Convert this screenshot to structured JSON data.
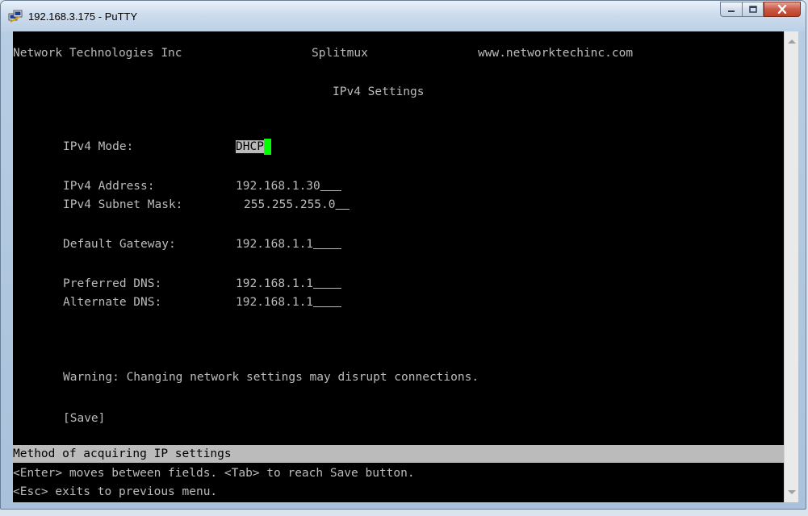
{
  "window": {
    "title": "192.168.3.175 - PuTTY",
    "icon": "putty-icon"
  },
  "controls": {
    "minimize_icon": "minimize-icon",
    "maximize_icon": "maximize-icon",
    "close_icon": "close-icon"
  },
  "terminal": {
    "header": {
      "company": "Network Technologies Inc",
      "product": "Splitmux",
      "website": "www.networktechinc.com"
    },
    "screen_title": "IPv4 Settings",
    "fields": {
      "mode": {
        "label": "IPv4 Mode:",
        "value": "DHCP"
      },
      "address": {
        "label": "IPv4 Address:",
        "value": "192.168.1.30",
        "pad": "   "
      },
      "subnet": {
        "label": "IPv4 Subnet Mask:",
        "value": "255.255.255.0",
        "pad": "  "
      },
      "gateway": {
        "label": "Default Gateway:",
        "value": "192.168.1.1",
        "pad": "    "
      },
      "preferred_dns": {
        "label": "Preferred DNS:",
        "value": "192.168.1.1",
        "pad": "    "
      },
      "alternate_dns": {
        "label": "Alternate DNS:",
        "value": "192.168.1.1",
        "pad": "    "
      }
    },
    "warning": "Warning: Changing network settings may disrupt connections.",
    "save_label": "[Save]",
    "status": "Method of acquiring IP settings",
    "help_line_1": "<Enter> moves between fields. <Tab> to reach Save button.",
    "help_line_2": "<Esc> exits to previous menu."
  },
  "colors": {
    "terminal_bg": "#000000",
    "terminal_fg": "#bbbbbb",
    "cursor": "#00ff00",
    "status_bg": "#bbbbbb"
  }
}
